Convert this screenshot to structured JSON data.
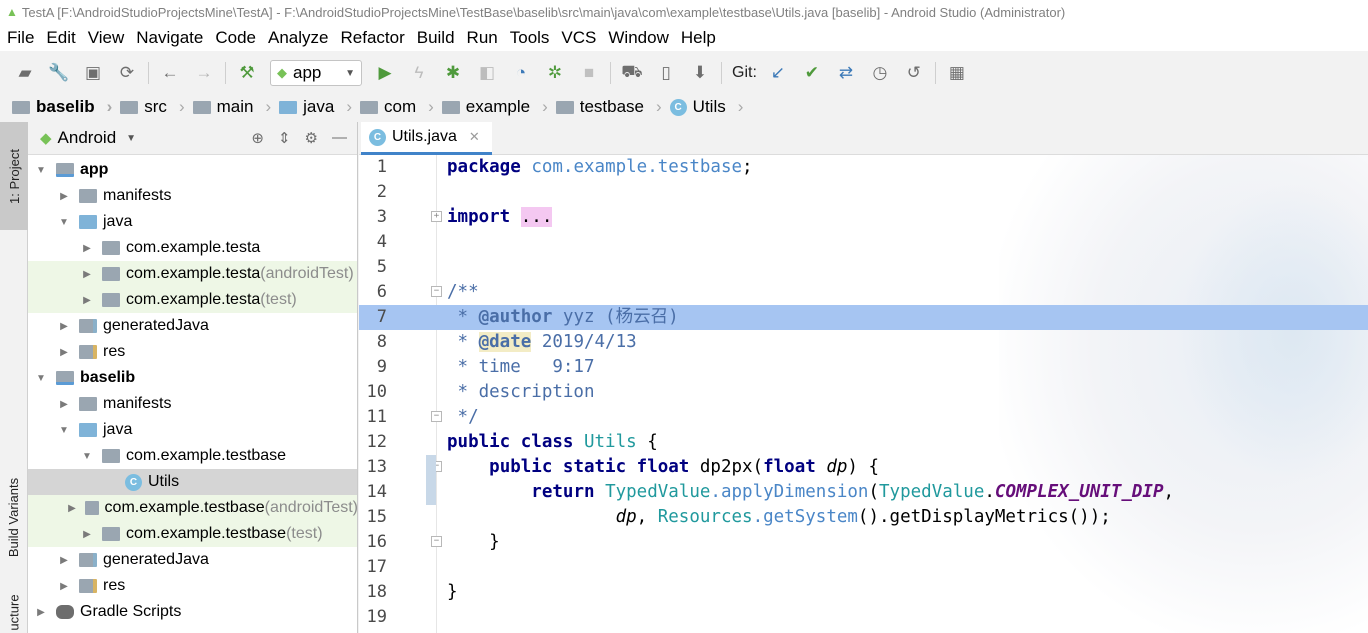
{
  "title_bar": {
    "text": "TestA [F:\\AndroidStudioProjectsMine\\TestA] - F:\\AndroidStudioProjectsMine\\TestBase\\baselib\\src\\main\\java\\com\\example\\testbase\\Utils.java [baselib] - Android Studio (Administrator)"
  },
  "menu": [
    "File",
    "Edit",
    "View",
    "Navigate",
    "Code",
    "Analyze",
    "Refactor",
    "Build",
    "Run",
    "Tools",
    "VCS",
    "Window",
    "Help"
  ],
  "toolbar": {
    "run_config": "app",
    "git_label": "Git:"
  },
  "breadcrumbs": [
    "baselib",
    "src",
    "main",
    "java",
    "com",
    "example",
    "testbase",
    "Utils"
  ],
  "side_stripe": {
    "project_tab": "1: Project",
    "build_variants_tab": "Build Variants",
    "structure_tab": "ucture"
  },
  "project_panel": {
    "view_mode": "Android",
    "tree": [
      {
        "label": "app",
        "suffix": "",
        "bold": true
      },
      {
        "label": "manifests",
        "suffix": ""
      },
      {
        "label": "java",
        "suffix": ""
      },
      {
        "label": "com.example.testa",
        "suffix": ""
      },
      {
        "label": "com.example.testa",
        "suffix": " (androidTest)"
      },
      {
        "label": "com.example.testa",
        "suffix": " (test)"
      },
      {
        "label": "generatedJava",
        "suffix": ""
      },
      {
        "label": "res",
        "suffix": ""
      },
      {
        "label": "baselib",
        "suffix": "",
        "bold": true
      },
      {
        "label": "manifests",
        "suffix": ""
      },
      {
        "label": "java",
        "suffix": ""
      },
      {
        "label": "com.example.testbase",
        "suffix": ""
      },
      {
        "label": "Utils",
        "suffix": ""
      },
      {
        "label": "com.example.testbase",
        "suffix": " (androidTest)"
      },
      {
        "label": "com.example.testbase",
        "suffix": " (test)"
      },
      {
        "label": "generatedJava",
        "suffix": ""
      },
      {
        "label": "res",
        "suffix": ""
      },
      {
        "label": "Gradle Scripts",
        "suffix": ""
      }
    ]
  },
  "editor": {
    "tab": "Utils.java",
    "line_numbers": [
      "1",
      "2",
      "3",
      "4",
      "5",
      "6",
      "7",
      "8",
      "9",
      "10",
      "11",
      "12",
      "13",
      "14",
      "15",
      "16",
      "17",
      "18",
      "19"
    ],
    "current_line": 7,
    "code": {
      "l1_kw": "package",
      "l1_pkg": "com.example.testbase",
      "l1_end": ";",
      "l3_kw": "import",
      "l3_fold": "...",
      "l6": "/**",
      "l7_star": " * ",
      "l7_tag": "@author",
      "l7_text": " yyz (杨云召)",
      "l8_star": " * ",
      "l8_tag": "@date",
      "l8_text": " 2019/4/13",
      "l9": " * time   9:17",
      "l10": " * description",
      "l11": " */",
      "l12_kw": "public class",
      "l12_cls": "Utils",
      "l12_end": " {",
      "l13_kw": "public static float",
      "l13_m": " dp2px(",
      "l13_kw2": "float",
      "l13_p": " dp",
      "l13_end": ") {",
      "l14_kw": "return",
      "l14_c1": "TypedValue",
      "l14_m": ".applyDimension",
      "l14_o": "(",
      "l14_c2": "TypedValue",
      "l14_dot": ".",
      "l14_st": "COMPLEX_UNIT_DIP",
      "l14_end": ",",
      "l15_p": "dp",
      "l15_c": ", ",
      "l15_cls": "Resources",
      "l15_m": ".getSystem",
      "l15_end": "().getDisplayMetrics());",
      "l16": "}",
      "l18": "}"
    }
  }
}
